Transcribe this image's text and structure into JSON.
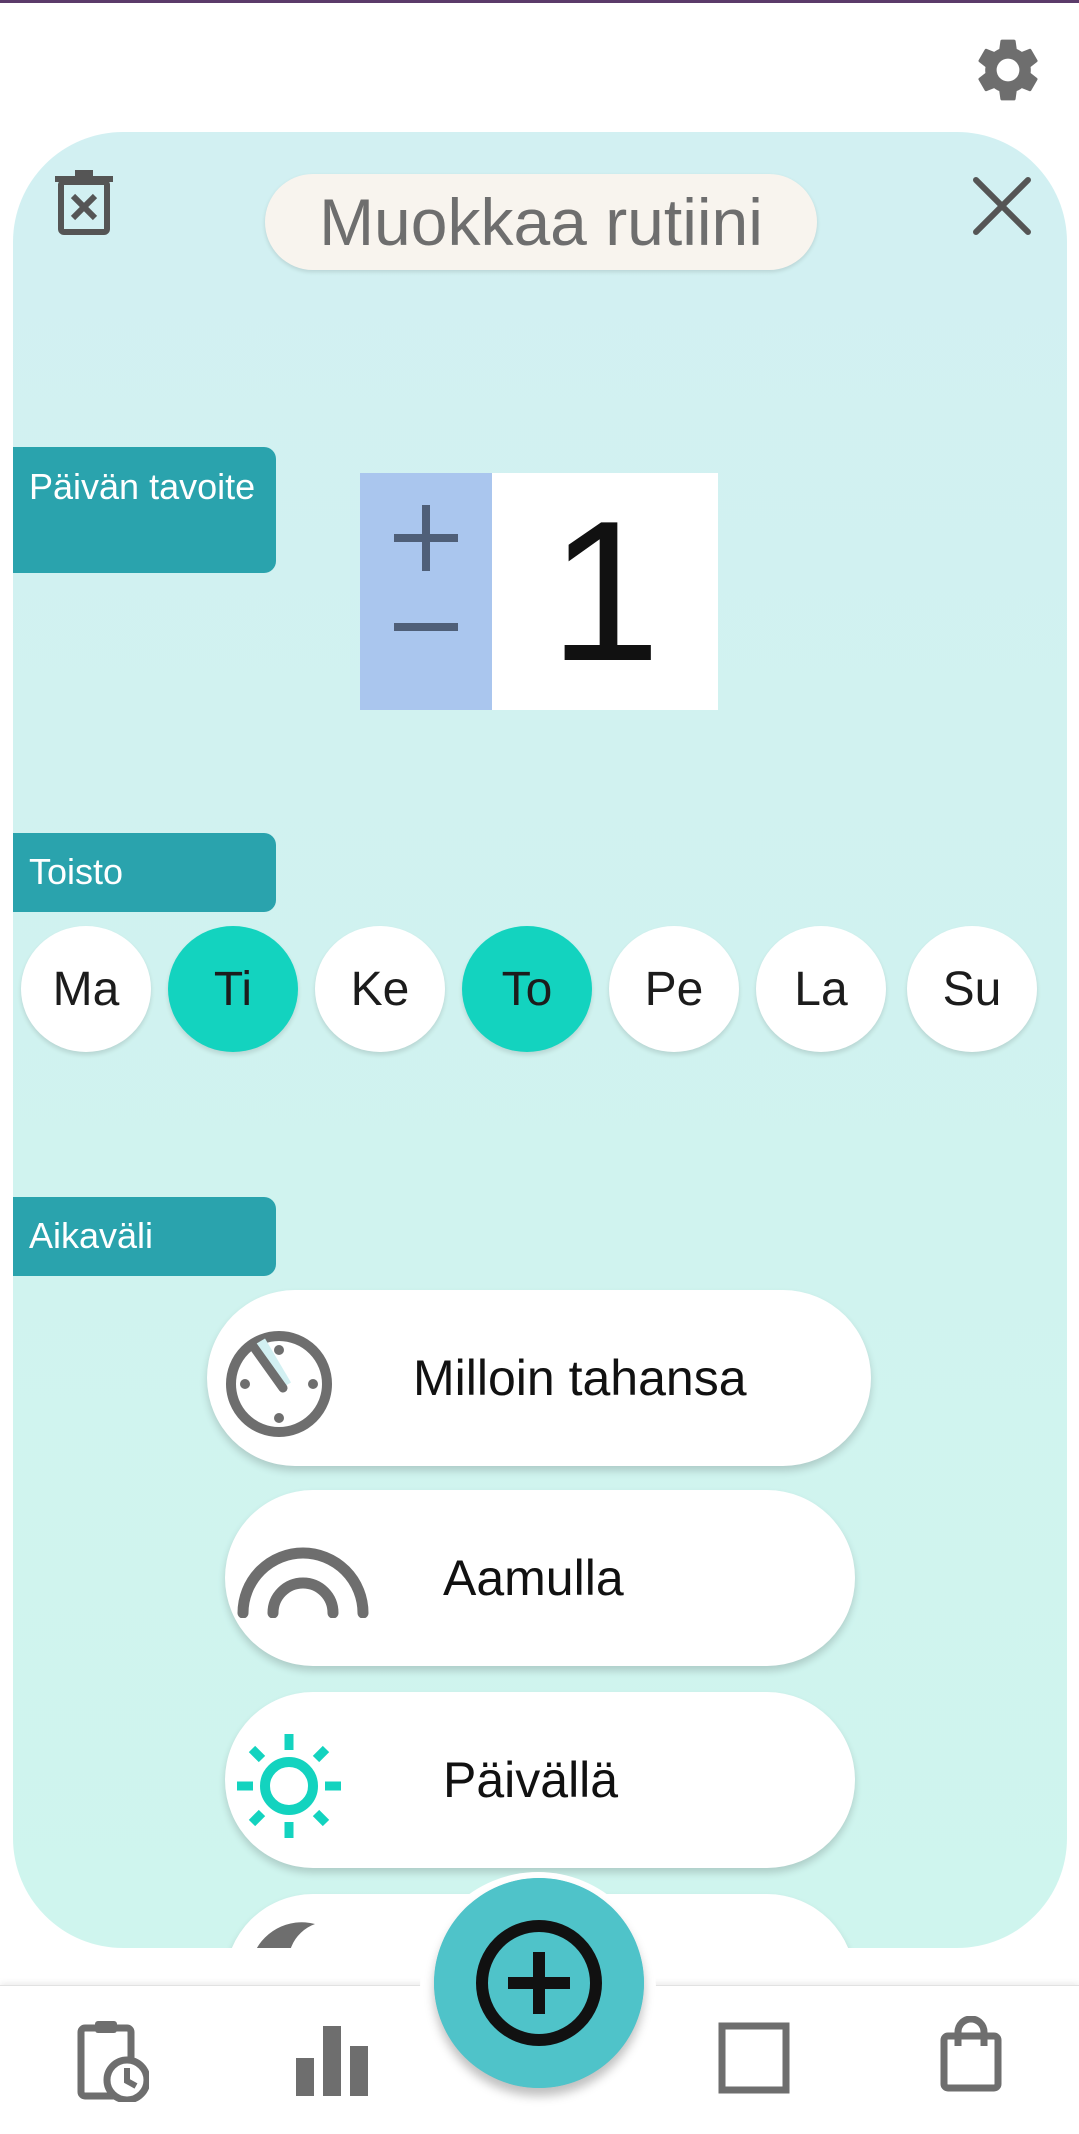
{
  "header": {
    "settings_icon": "gear-icon"
  },
  "dialog": {
    "title": "Muokkaa rutiini",
    "delete_icon": "trash-icon",
    "close_icon": "close-icon"
  },
  "daily_goal": {
    "label": "Päivän tavoite",
    "value": "1",
    "increment_icon": "plus-icon",
    "decrement_icon": "minus-icon"
  },
  "repeat": {
    "label": "Toisto",
    "days": [
      {
        "label": "Ma",
        "selected": false
      },
      {
        "label": "Ti",
        "selected": true
      },
      {
        "label": "Ke",
        "selected": false
      },
      {
        "label": "To",
        "selected": true
      },
      {
        "label": "Pe",
        "selected": false
      },
      {
        "label": "La",
        "selected": false
      },
      {
        "label": "Su",
        "selected": false
      }
    ]
  },
  "time_range": {
    "label": "Aikaväli",
    "options": [
      {
        "label": "Milloin tahansa",
        "icon": "clock-dial-icon"
      },
      {
        "label": "Aamulla",
        "icon": "sunrise-arc-icon"
      },
      {
        "label": "Päivällä",
        "icon": "sun-icon"
      },
      {
        "label": "",
        "icon": "moon-icon"
      }
    ]
  },
  "bottom_nav": {
    "items": [
      "clipboard-clock-icon",
      "bar-chart-icon",
      "add-circle-icon",
      "square-icon",
      "shopping-bag-icon"
    ]
  },
  "colors": {
    "accent": "#2aa3ad",
    "selected_day": "#13d3bf",
    "card_bg": "#d2f0f2",
    "stepper_bg": "#aac6ee",
    "fab": "#4fc3c9",
    "sun_icon": "#13d3bf"
  }
}
